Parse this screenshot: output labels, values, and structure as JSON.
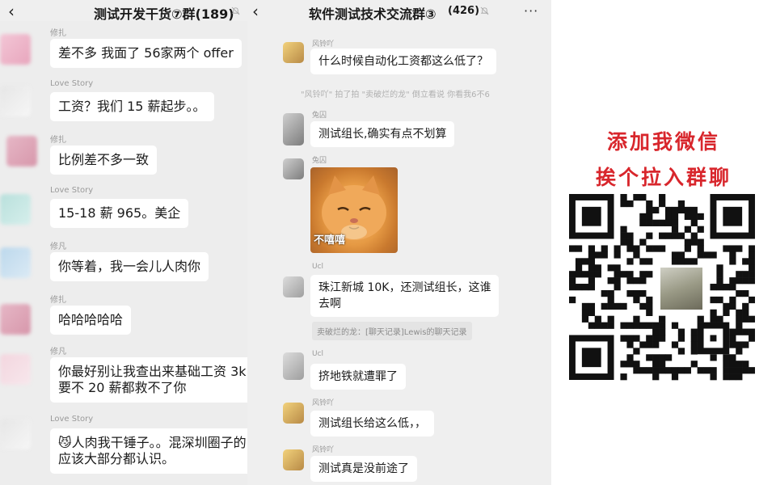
{
  "left_chat": {
    "title": "测试开发干货⑦群(189)",
    "messages": [
      {
        "sender": "修扎",
        "lines": [
          "差不多 我面了 56家两个 offer"
        ]
      },
      {
        "sender": "Love Story",
        "lines": [
          "工资？我们 15 薪起步。。"
        ]
      },
      {
        "sender": "修扎",
        "lines": [
          "比例差不多一致"
        ]
      },
      {
        "sender": "Love Story",
        "lines": [
          "15-18 薪  965。美企"
        ]
      },
      {
        "sender": "修凡",
        "lines": [
          "你等着，我一会儿人肉你"
        ]
      },
      {
        "sender": "修扎",
        "lines": [
          "哈哈哈哈哈"
        ]
      },
      {
        "sender": "修凡",
        "lines": [
          "你最好别让我查出来基础工资 3k，",
          "要不 20 薪都救不了你"
        ]
      },
      {
        "sender": "Love Story",
        "lines": [
          "😼人肉我干锤子。。混深圳圈子的",
          "应该大部分都认识。"
        ]
      }
    ]
  },
  "mid_chat": {
    "title": "软件测试技术交流群③",
    "count": "(426)",
    "more": "···",
    "messages": [
      {
        "sender": "风铃吖",
        "lines": [
          "什么时候自动化工资都这么低了？"
        ]
      },
      {
        "sender": "兔囚",
        "lines": [
          "测试组长,确实有点不划算"
        ]
      },
      {
        "sender": "兔囚",
        "sticker_text": "不嘻嘻"
      },
      {
        "sender": "Ucl",
        "lines": [
          "珠江新城 10K，还测试组长，这谁",
          "去啊"
        ]
      },
      {
        "sender": "Ucl",
        "lines": [
          "挤地铁就遭罪了"
        ]
      },
      {
        "sender": "风铃吖",
        "lines": [
          "测试组长给这么低，，"
        ]
      },
      {
        "sender": "风铃吖",
        "lines": [
          "测试真是没前途了"
        ]
      }
    ],
    "system_note": "\"风铃吖\" 拍了拍 \"卖破烂的龙\" 倒立看说 你看我6不6",
    "quote": "卖破烂的龙：[聊天记录]Lewis的聊天记录"
  },
  "promo": {
    "line1": "添加我微信",
    "line2": "挨个拉入群聊"
  },
  "colors": {
    "chat_bg": "#ededed",
    "bubble": "#ffffff",
    "accent_red": "#d8262c",
    "meta_gray": "#9a9a9a"
  },
  "icons": [
    "back-arrow-icon",
    "mute-icon",
    "more-icon",
    "qr-code-icon"
  ]
}
